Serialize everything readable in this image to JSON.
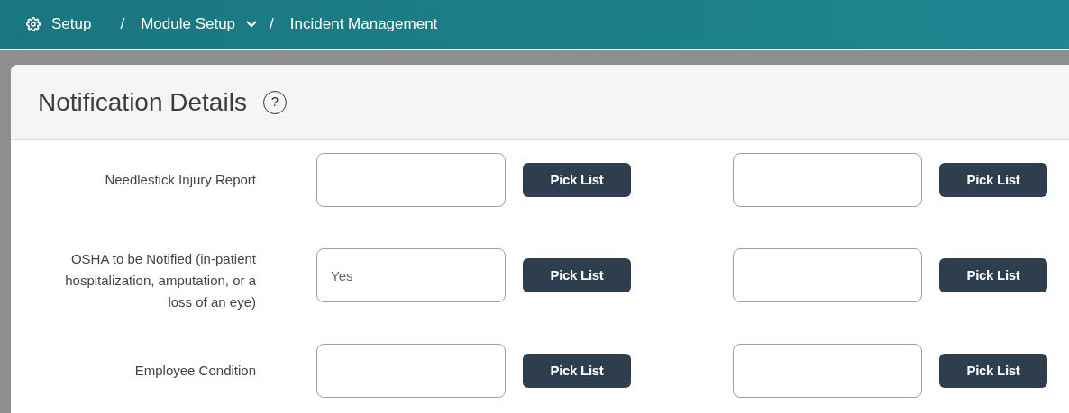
{
  "breadcrumb": [
    {
      "label": "Setup",
      "kind": "home"
    },
    {
      "label": "Module Setup",
      "kind": "dropdown"
    },
    {
      "label": "Incident Management",
      "kind": "current"
    }
  ],
  "breadcrumb_separators": [
    "/",
    "/"
  ],
  "panel": {
    "title": "Notification Details",
    "help": "?"
  },
  "rows": [
    {
      "label": "Needlestick Injury Report",
      "fields": [
        {
          "button": "Pick List"
        },
        {
          "button": "Pick List"
        }
      ]
    },
    {
      "label": "OSHA to be Notified (in-patient hospitalization, amputation, or a loss of an eye)",
      "fields": [
        {
          "value": "Yes",
          "button": "Pick List"
        },
        {
          "button": "Pick List"
        }
      ]
    },
    {
      "label": "Employee Condition",
      "fields": [
        {
          "button": "Pick List"
        },
        {
          "button": "Pick List"
        }
      ]
    }
  ]
}
